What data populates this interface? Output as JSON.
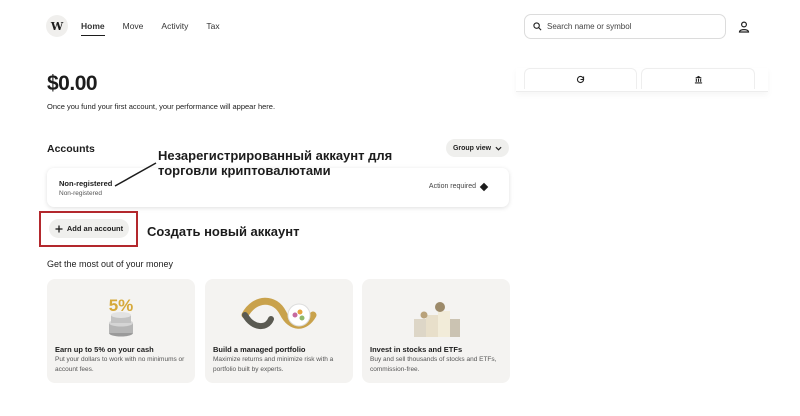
{
  "header": {
    "logo": "W",
    "nav": [
      "Home",
      "Move",
      "Activity",
      "Tax"
    ],
    "search_placeholder": "Search name or symbol",
    "icons": [
      "search-icon",
      "user-icon"
    ]
  },
  "summary": {
    "balance": "$0.00",
    "subtitle": "Once you fund your first account, your performance will appear here."
  },
  "right_panel": {
    "tab_icons": [
      "chart-refresh-icon",
      "bank-icon"
    ]
  },
  "accounts": {
    "title": "Accounts",
    "group_view": "Group view",
    "items": [
      {
        "name": "Non-registered",
        "type": "Non-registered",
        "status": "Action required"
      }
    ],
    "add_button": "Add an account"
  },
  "annotations": {
    "account_note": "Незарегистрированный аккаунт для торговли криптовалютами",
    "add_note": "Создать новый аккаунт"
  },
  "promos": {
    "title": "Get the most out of your money",
    "cards": [
      {
        "title": "Earn up to 5% on your cash",
        "desc": "Put your dollars to work with no minimums or account fees.",
        "art_text": "5%"
      },
      {
        "title": "Build a managed portfolio",
        "desc": "Maximize returns and minimize risk with a portfolio built by experts."
      },
      {
        "title": "Invest in stocks and ETFs",
        "desc": "Buy and sell thousands of stocks and ETFs, commission-free."
      }
    ]
  },
  "colors": {
    "highlight_frame": "#b3282d",
    "card_bg": "#f4f3f1",
    "pill_bg": "#efefed"
  }
}
